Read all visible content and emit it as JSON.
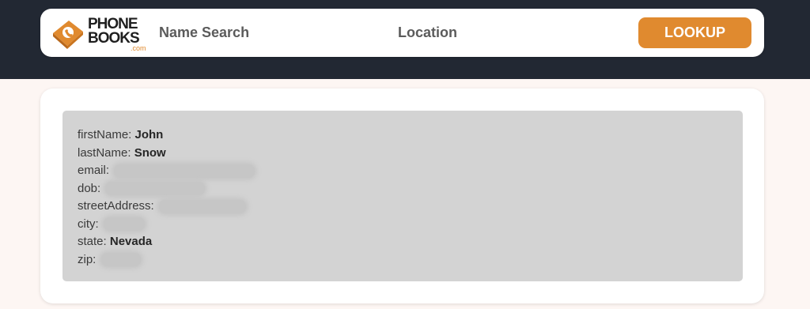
{
  "header": {
    "logo": {
      "line1": "PHONE",
      "line2": "BOOKS",
      "suffix": ".com"
    },
    "nav": [
      {
        "label": "Name Search"
      },
      {
        "label": "Location"
      }
    ],
    "lookup_label": "LOOKUP",
    "accent_color": "#e08a2f",
    "background_color": "#222833"
  },
  "result": {
    "fields": [
      {
        "key": "firstName:",
        "value": "John"
      },
      {
        "key": "lastName:",
        "value": "Snow"
      },
      {
        "key": "email:",
        "value": null
      },
      {
        "key": "dob:",
        "value": null
      },
      {
        "key": "streetAddress:",
        "value": null
      },
      {
        "key": "city:",
        "value": null
      },
      {
        "key": "state:",
        "value": "Nevada"
      },
      {
        "key": "zip:",
        "value": null
      }
    ]
  }
}
